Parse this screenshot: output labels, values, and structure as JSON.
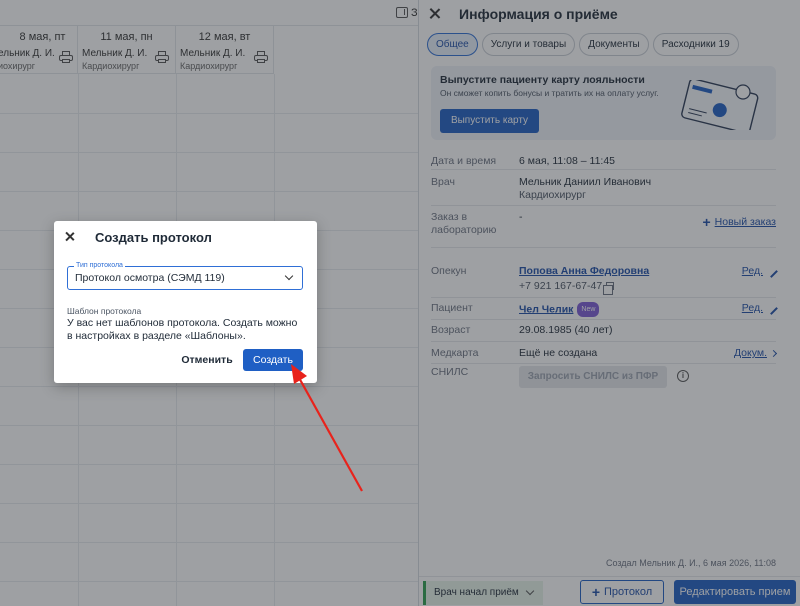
{
  "calendar": {
    "topbar_text": "За",
    "days": [
      {
        "date": "8 мая, пт",
        "doctor": "",
        "spec": ""
      },
      {
        "date": "11 мая, пн",
        "doctor": "Мельник Д. И.",
        "spec": "Кардиохирург"
      },
      {
        "date": "12 мая, вт",
        "doctor": "Мельник Д. И.",
        "spec": "Кардиохирург"
      }
    ],
    "first_doctor": "ельник Д. И.",
    "first_spec": "иохирург"
  },
  "panel": {
    "title": "Информация о приёме",
    "tabs": [
      "Общее",
      "Услуги и товары",
      "Документы",
      "Расходники 19"
    ],
    "active_tab": "Общее",
    "loyalty": {
      "title": "Выпустите пациенту карту лояльности",
      "text": "Он сможет копить бонусы и тратить их на оплату услуг.",
      "button": "Выпустить карту"
    },
    "rows": {
      "datetime": {
        "label": "Дата и время",
        "value": "6 мая, 11:08 – 11:45"
      },
      "doctor": {
        "label": "Врач",
        "name": "Мельник Даниил Иванович",
        "spec": "Кардиохирург"
      },
      "lab": {
        "label_1": "Заказ в",
        "label_2": "лабораторию",
        "value": "-",
        "action": "Новый заказ"
      },
      "guardian": {
        "label": "Опекун",
        "name": "Попова Анна Федоровна",
        "phone": "+7 921 167-67-47",
        "action": "Ред."
      },
      "patient": {
        "label": "Пациент",
        "name": "Чел Челик",
        "badge": "New",
        "action": "Ред."
      },
      "age": {
        "label": "Возраст",
        "value": "29.08.1985 (40 лет)"
      },
      "medcard": {
        "label": "Медкарта",
        "value": "Ещё не создана",
        "action": "Докум."
      },
      "snils": {
        "label": "СНИЛС",
        "button": "Запросить СНИЛС из ПФР"
      }
    },
    "created": "Создал Мельник Д. И., 6 мая 2026, 11:08",
    "footer": {
      "status": "Врач начал приём",
      "protocol_button": "Протокол",
      "edit_button": "Редактировать прием"
    }
  },
  "modal": {
    "title": "Создать протокол",
    "type_label": "Тип протокола",
    "type_value": "Протокол осмотра (СЭМД 119)",
    "template_label": "Шаблон протокола",
    "template_text": "У вас нет шаблонов протокола. Создать можно в настройках в разделе «Шаблоны».",
    "cancel": "Отменить",
    "create": "Создать"
  },
  "colors": {
    "primary": "#1f5fc4",
    "overlay": "rgba(40,44,52,0.45)",
    "annotation_arrow": "#e8231c",
    "status_green": "#2e9e4f"
  }
}
